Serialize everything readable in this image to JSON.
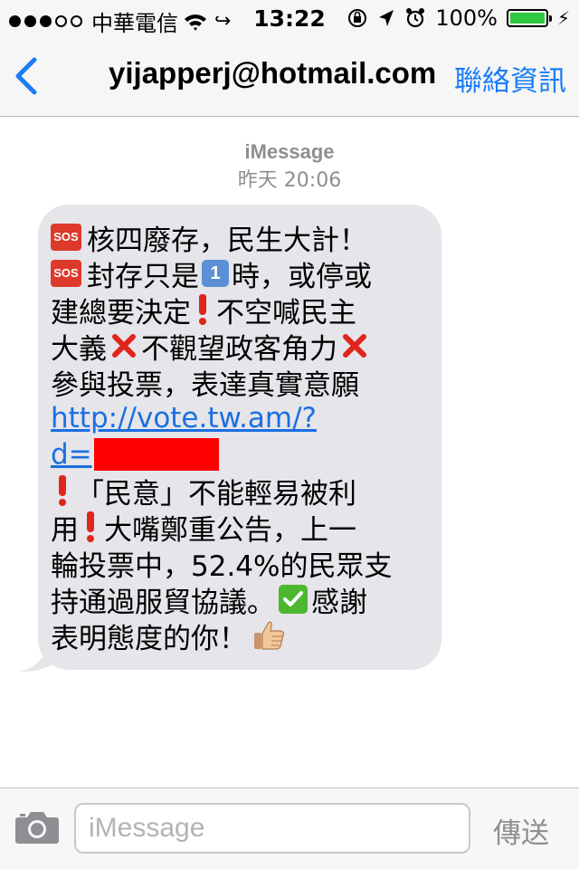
{
  "status_bar": {
    "carrier": "中華電信",
    "time": "13:22",
    "battery": "100%",
    "signal_bars": 3,
    "signal_total": 5
  },
  "nav": {
    "back_icon": "chevron-left-icon",
    "title": "yijapperj@hotmail.com",
    "action": "聯絡資訊"
  },
  "conversation": {
    "service": "iMessage",
    "timestamp": "昨天 20:06"
  },
  "message": {
    "line1": "核四廢存，民生大計！",
    "line2a": "封存只是",
    "line2b": "時，或停或",
    "line3": "建總要決定",
    "line3b": "不空喊民主",
    "line4a": "大義",
    "line4b": "不觀望政客角力",
    "line5": "參與投票，表達真實意願",
    "link1": "http://vote.tw.am/?",
    "link2": "d=",
    "line8": "「民意」不能輕易被利",
    "line9a": "用",
    "line9b": "大嘴鄭重公告，上一",
    "line10": "輪投票中，52.4%的民眾支",
    "line11": "持通過服貿協議。",
    "line11b": "感謝",
    "line12": "表明態度的你！",
    "keycap": "1",
    "sos": "SOS"
  },
  "input": {
    "placeholder": "iMessage",
    "send": "傳送",
    "camera_icon": "camera-icon"
  },
  "colors": {
    "accent": "#1a7df7",
    "bubble": "#e5e5ea",
    "link": "#1b6fe0",
    "redaction": "#fe0000"
  }
}
